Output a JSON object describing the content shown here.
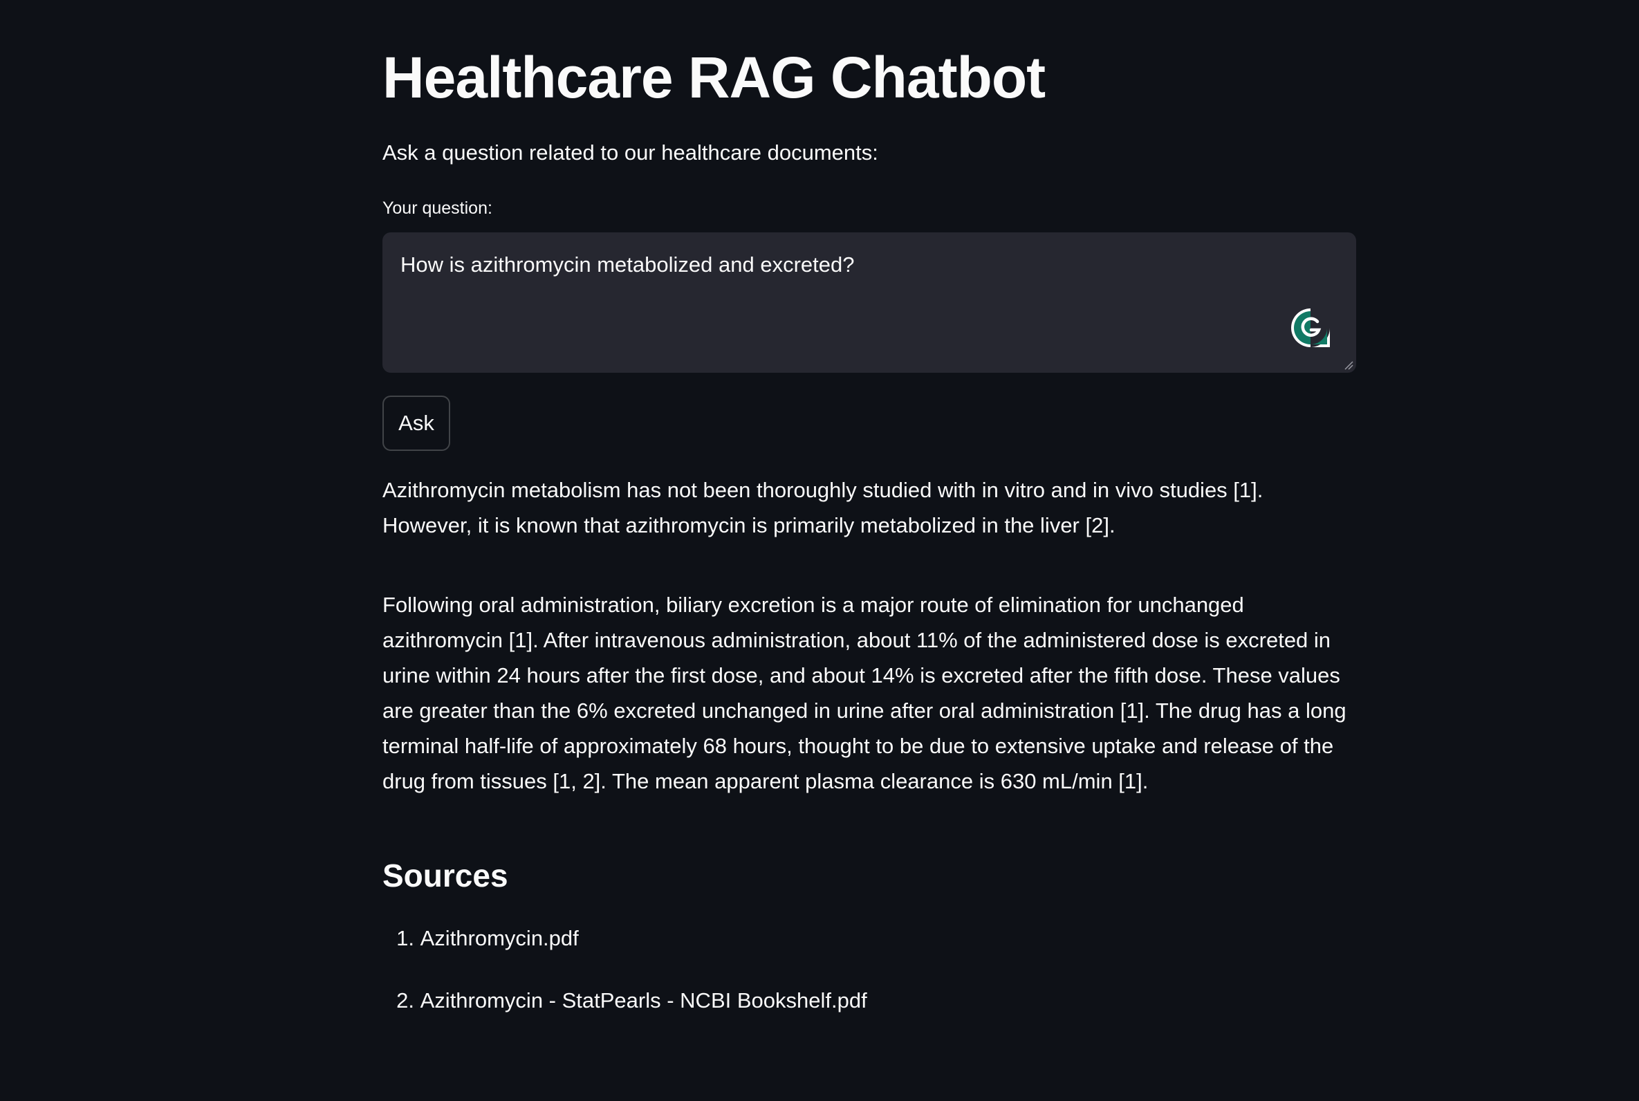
{
  "page": {
    "title": "Healthcare RAG Chatbot",
    "intro": "Ask a question related to our healthcare documents:"
  },
  "question": {
    "label": "Your question:",
    "value": "How is azithromycin metabolized and excreted?",
    "grammarly_icon": "grammarly-icon"
  },
  "ask_button": {
    "label": "Ask"
  },
  "answer": {
    "paragraphs": [
      "Azithromycin metabolism has not been thoroughly studied with in vitro and in vivo studies [1]. However, it is known that azithromycin is primarily metabolized in the liver [2].",
      "Following oral administration, biliary excretion is a major route of elimination for unchanged azithromycin [1]. After intravenous administration, about 11% of the administered dose is excreted in urine within 24 hours after the first dose, and about 14% is excreted after the fifth dose. These values are greater than the 6% excreted unchanged in urine after oral administration [1]. The drug has a long terminal half-life of approximately 68 hours, thought to be due to extensive uptake and release of the drug from tissues [1, 2]. The mean apparent plasma clearance is 630 mL/min [1]."
    ]
  },
  "sources": {
    "heading": "Sources",
    "items": [
      {
        "number": "1.",
        "name": "Azithromycin.pdf"
      },
      {
        "number": "2.",
        "name": "Azithromycin - StatPearls - NCBI Bookshelf.pdf"
      }
    ]
  },
  "colors": {
    "background": "#0e1117",
    "text": "#fafafa",
    "input_background": "#262730",
    "grammarly_green": "#15c39a"
  }
}
